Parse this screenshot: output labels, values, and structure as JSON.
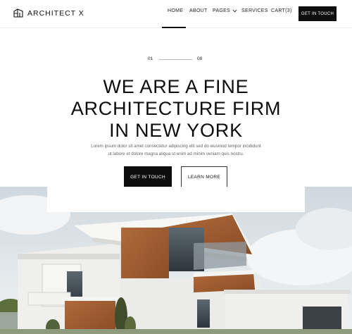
{
  "brand": {
    "name": "ARCHITECT X",
    "icon": "building-icon"
  },
  "nav": {
    "home": "HOME",
    "about": "ABOUT",
    "pages": "PAGES",
    "services": "SERVICES",
    "cart": "CART(3)",
    "cta": "GET IN TOUCH",
    "active": "HOME"
  },
  "slider": {
    "current": "01",
    "total": "08"
  },
  "hero": {
    "title_line1": "WE ARE A FINE",
    "title_line2": "ARCHITECTURE FIRM",
    "title_line3": "IN NEW YORK",
    "desc_line1": "Lorem ipsum dolor sit amet consectetur adipiscing elit sed do eiusmod tempor incididunt",
    "desc_line2": "ut labore et dolore magna aliqua ut enim ad minim veniam quis nostru.",
    "primary_button": "GET IN TOUCH",
    "secondary_button": "LEARN MORE"
  },
  "colors": {
    "primary": "#0d0d0d",
    "background": "#ffffff",
    "muted_text": "#666666"
  }
}
